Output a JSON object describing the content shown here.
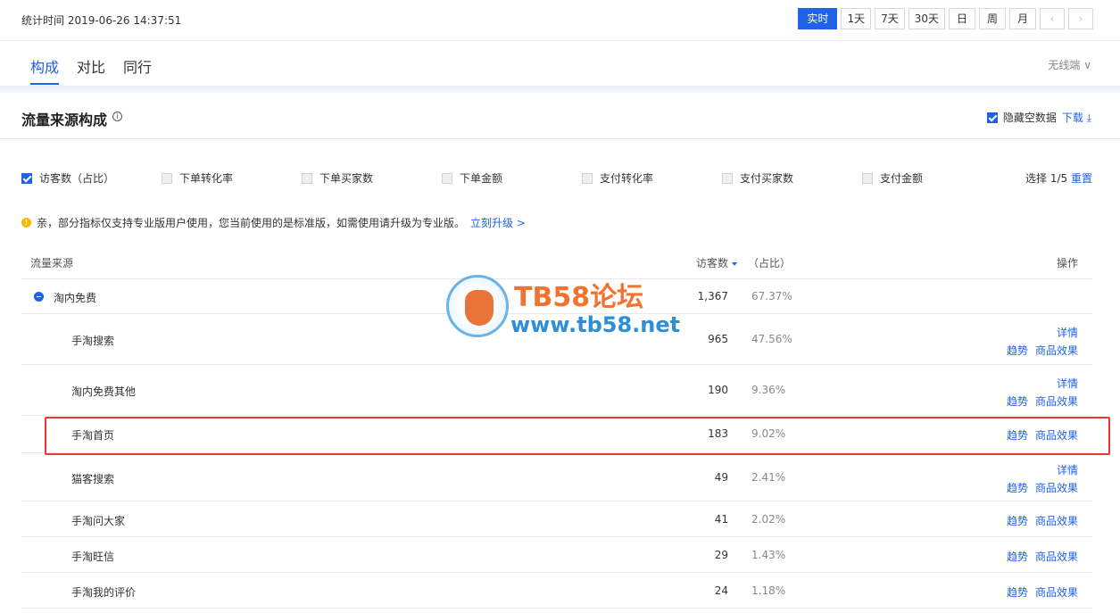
{
  "header": {
    "stat_time": "统计时间 2019-06-26 14:37:51",
    "ranges": [
      "实时",
      "1天",
      "7天",
      "30天",
      "日",
      "周",
      "月"
    ],
    "active_range": "实时",
    "prev": "‹",
    "next": "›"
  },
  "tabs": [
    {
      "label": "构成",
      "active": true
    },
    {
      "label": "对比",
      "active": false
    },
    {
      "label": "同行",
      "active": false
    }
  ],
  "device": "无线端 ∨",
  "section": {
    "title": "流量来源构成",
    "info_icon": "i",
    "hide_empty_label": "隐藏空数据",
    "download_label": "下载 ⤓"
  },
  "metrics": [
    {
      "label": "访客数（占比）",
      "checked": true
    },
    {
      "label": "下单转化率",
      "checked": false
    },
    {
      "label": "下单买家数",
      "checked": false
    },
    {
      "label": "下单金额",
      "checked": false
    },
    {
      "label": "支付转化率",
      "checked": false
    },
    {
      "label": "支付买家数",
      "checked": false
    },
    {
      "label": "支付金额",
      "checked": false
    }
  ],
  "select_info": "选择 1/5",
  "reset_label": "重置",
  "notice": {
    "text": "亲，部分指标仅支持专业版用户使用，您当前使用的是标准版，如需使用请升级为专业版。",
    "link": "立刻升级 >"
  },
  "table": {
    "headers": {
      "source": "流量来源",
      "visitors": "访客数",
      "ratio": "（占比）",
      "ops": "操作"
    },
    "rows": [
      {
        "name": "淘内免费",
        "visitors": "1,367",
        "ratio": "67.37%",
        "group": true,
        "detail": "",
        "trend": "",
        "effect": ""
      },
      {
        "name": "手淘搜索",
        "visitors": "965",
        "ratio": "47.56%",
        "detail": "详情",
        "trend": "趋势",
        "effect": "商品效果"
      },
      {
        "name": "淘内免费其他",
        "visitors": "190",
        "ratio": "9.36%",
        "detail": "详情",
        "trend": "趋势",
        "effect": "商品效果"
      },
      {
        "name": "手淘首页",
        "visitors": "183",
        "ratio": "9.02%",
        "detail": "",
        "trend": "趋势",
        "effect": "商品效果"
      },
      {
        "name": "猫客搜索",
        "visitors": "49",
        "ratio": "2.41%",
        "detail": "详情",
        "trend": "趋势",
        "effect": "商品效果"
      },
      {
        "name": "手淘问大家",
        "visitors": "41",
        "ratio": "2.02%",
        "detail": "",
        "trend": "趋势",
        "effect": "商品效果"
      },
      {
        "name": "手淘旺信",
        "visitors": "29",
        "ratio": "1.43%",
        "detail": "",
        "trend": "趋势",
        "effect": "商品效果"
      },
      {
        "name": "手淘我的评价",
        "visitors": "24",
        "ratio": "1.18%",
        "detail": "",
        "trend": "趋势",
        "effect": "商品效果"
      }
    ]
  },
  "watermark": {
    "title": "TB58论坛",
    "url": "www.tb58.net"
  }
}
